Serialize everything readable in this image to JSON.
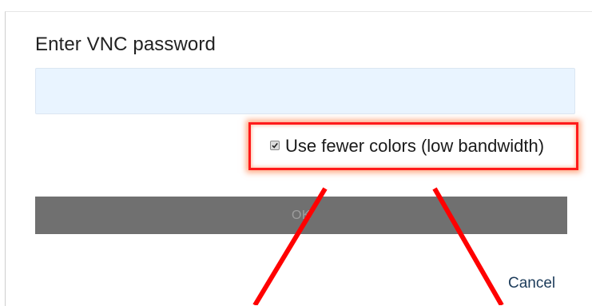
{
  "dialog": {
    "title": "Enter VNC password",
    "password_field": {
      "value": "",
      "placeholder": ""
    },
    "low_bandwidth_option": {
      "label": "Use fewer colors (low bandwidth)",
      "checked": true
    },
    "ok_label": "OK",
    "cancel_label": "Cancel"
  },
  "annotation": {
    "highlight_color": "#ff1a1a",
    "arrow_color": "#ff0000"
  },
  "colors": {
    "input_background": "#e9f4ff",
    "ok_button_background": "#707070",
    "cancel_link": "#1c3b5a"
  }
}
